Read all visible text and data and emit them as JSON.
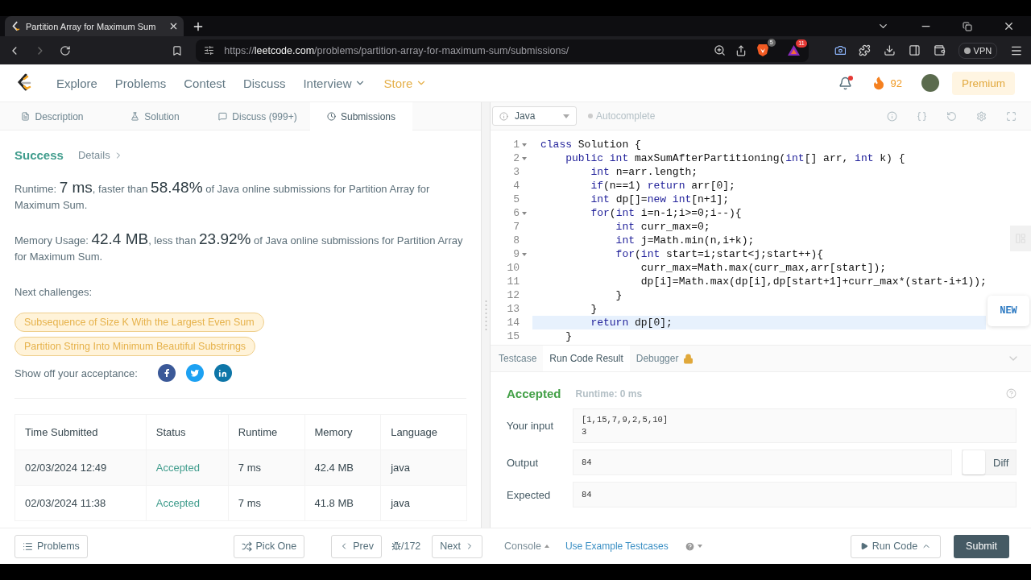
{
  "browser": {
    "tab": {
      "title": "Partition Array for Maximum Sum"
    },
    "url": {
      "scheme": "https://",
      "host": "leetcode.com",
      "path": "/problems/partition-array-for-maximum-sum/submissions/"
    },
    "badges": [
      "5",
      "11"
    ],
    "vpn": "VPN"
  },
  "nav": {
    "items": [
      {
        "label": "Explore",
        "dropdown": false,
        "kind": "link"
      },
      {
        "label": "Problems",
        "dropdown": false,
        "kind": "link"
      },
      {
        "label": "Contest",
        "dropdown": false,
        "kind": "link"
      },
      {
        "label": "Discuss",
        "dropdown": false,
        "kind": "link"
      },
      {
        "label": "Interview",
        "dropdown": true,
        "kind": "link"
      },
      {
        "label": "Store",
        "dropdown": true,
        "kind": "store"
      }
    ],
    "notification_dot": true,
    "streak": "92",
    "premium": "Premium"
  },
  "left_tabs": [
    {
      "label": "Description",
      "selected": false
    },
    {
      "label": "Solution",
      "selected": false
    },
    {
      "label": "Discuss (999+)",
      "selected": false
    },
    {
      "label": "Submissions",
      "selected": true
    }
  ],
  "result": {
    "status": "Success",
    "details": "Details",
    "runtime": [
      {
        "text": "Runtime: ",
        "kind": "label"
      },
      {
        "text": "7 ms",
        "kind": "value"
      },
      {
        "text": ", faster than ",
        "kind": "label"
      },
      {
        "text": "58.48%",
        "kind": "value"
      },
      {
        "text": " of Java online submissions for Partition Array for Maximum Sum.",
        "kind": "label"
      }
    ],
    "memory": [
      {
        "text": "Memory Usage: ",
        "kind": "label"
      },
      {
        "text": "42.4 MB",
        "kind": "value"
      },
      {
        "text": ", less than ",
        "kind": "label"
      },
      {
        "text": "23.92%",
        "kind": "value"
      },
      {
        "text": " of Java online submissions for Partition Array for Maximum Sum.",
        "kind": "label"
      }
    ],
    "next_label": "Next challenges:",
    "challenges": [
      "Subsequence of Size K With the Largest Even Sum",
      "Partition String Into Minimum Beautiful Substrings"
    ],
    "share_label": "Show off your acceptance:"
  },
  "submissions": {
    "columns": [
      "Time Submitted",
      "Status",
      "Runtime",
      "Memory",
      "Language"
    ],
    "rows": [
      {
        "time": "02/03/2024 12:49",
        "status": "Accepted",
        "runtime": "7 ms",
        "memory": "42.4 MB",
        "language": "java"
      },
      {
        "time": "02/03/2024 11:38",
        "status": "Accepted",
        "runtime": "7 ms",
        "memory": "41.8 MB",
        "language": "java"
      }
    ]
  },
  "editor": {
    "language": "Java",
    "autocomplete": "Autocomplete",
    "autocomplete_on": false,
    "new_badge": "NEW",
    "lines": [
      {
        "number": "1",
        "fold": true,
        "active": false,
        "tokens": [
          {
            "text": "class",
            "kind": "keyword"
          },
          {
            "text": " Solution {",
            "kind": "text"
          }
        ]
      },
      {
        "number": "2",
        "fold": true,
        "active": false,
        "tokens": [
          {
            "text": "    public int",
            "kind": "keyword"
          },
          {
            "text": " maxSumAfterPartitioning(",
            "kind": "text"
          },
          {
            "text": "int",
            "kind": "keyword"
          },
          {
            "text": "[] arr, ",
            "kind": "text"
          },
          {
            "text": "int",
            "kind": "keyword"
          },
          {
            "text": " k) {",
            "kind": "text"
          }
        ]
      },
      {
        "number": "3",
        "fold": false,
        "active": false,
        "tokens": [
          {
            "text": "        int",
            "kind": "keyword"
          },
          {
            "text": " n=arr.length;",
            "kind": "text"
          }
        ]
      },
      {
        "number": "4",
        "fold": false,
        "active": false,
        "tokens": [
          {
            "text": "        if",
            "kind": "keyword"
          },
          {
            "text": "(n==1) ",
            "kind": "text"
          },
          {
            "text": "return",
            "kind": "keyword"
          },
          {
            "text": " arr[0];",
            "kind": "text"
          }
        ]
      },
      {
        "number": "5",
        "fold": false,
        "active": false,
        "tokens": [
          {
            "text": "        int",
            "kind": "keyword"
          },
          {
            "text": " dp[]=",
            "kind": "text"
          },
          {
            "text": "new int",
            "kind": "keyword"
          },
          {
            "text": "[n+1];",
            "kind": "text"
          }
        ]
      },
      {
        "number": "6",
        "fold": true,
        "active": false,
        "tokens": [
          {
            "text": "        for",
            "kind": "keyword"
          },
          {
            "text": "(",
            "kind": "text"
          },
          {
            "text": "int",
            "kind": "keyword"
          },
          {
            "text": " i=n-1;i>=0;i--){",
            "kind": "text"
          }
        ]
      },
      {
        "number": "7",
        "fold": false,
        "active": false,
        "tokens": [
          {
            "text": "            int",
            "kind": "keyword"
          },
          {
            "text": " curr_max=0;",
            "kind": "text"
          }
        ]
      },
      {
        "number": "8",
        "fold": false,
        "active": false,
        "tokens": [
          {
            "text": "            int",
            "kind": "keyword"
          },
          {
            "text": " j=Math.min(n,i+k);",
            "kind": "text"
          }
        ]
      },
      {
        "number": "9",
        "fold": true,
        "active": false,
        "tokens": [
          {
            "text": "            for",
            "kind": "keyword"
          },
          {
            "text": "(",
            "kind": "text"
          },
          {
            "text": "int",
            "kind": "keyword"
          },
          {
            "text": " start=i;start<j;start++){",
            "kind": "text"
          }
        ]
      },
      {
        "number": "10",
        "fold": false,
        "active": false,
        "tokens": [
          {
            "text": "                curr_max=Math.max(curr_max,arr[start]);",
            "kind": "text"
          }
        ]
      },
      {
        "number": "11",
        "fold": false,
        "active": false,
        "tokens": [
          {
            "text": "                dp[i]=Math.max(dp[i],dp[start+1]+curr_max*(start-i+1));",
            "kind": "text"
          }
        ]
      },
      {
        "number": "12",
        "fold": false,
        "active": false,
        "tokens": [
          {
            "text": "            }",
            "kind": "text"
          }
        ]
      },
      {
        "number": "13",
        "fold": false,
        "active": false,
        "tokens": [
          {
            "text": "        }",
            "kind": "text"
          }
        ]
      },
      {
        "number": "14",
        "fold": false,
        "active": true,
        "tokens": [
          {
            "text": "        return",
            "kind": "keyword"
          },
          {
            "text": " dp[0];",
            "kind": "text"
          }
        ]
      },
      {
        "number": "15",
        "fold": false,
        "active": false,
        "tokens": [
          {
            "text": "    }",
            "kind": "text"
          }
        ]
      }
    ]
  },
  "console": {
    "tabs": [
      {
        "label": "Testcase",
        "selected": false,
        "locked": false
      },
      {
        "label": "Run Code Result",
        "selected": true,
        "locked": false
      },
      {
        "label": "Debugger",
        "selected": false,
        "locked": true
      }
    ],
    "status": "Accepted",
    "runtime": "Runtime: 0 ms",
    "fields": [
      {
        "label": "Your input",
        "lines": [
          "[1,15,7,9,2,5,10]",
          "3"
        ]
      },
      {
        "label": "Output",
        "lines": [
          "84"
        ],
        "diff": {
          "label": "Diff",
          "checked": false
        }
      },
      {
        "label": "Expected",
        "lines": [
          "84"
        ]
      }
    ]
  },
  "footer": {
    "problems": "Problems",
    "pick_one": "Pick One",
    "prev": "Prev",
    "page": "/172",
    "next": "Next",
    "console": "Console",
    "example": "Use Example Testcases",
    "run": "Run Code",
    "submit": "Submit"
  }
}
